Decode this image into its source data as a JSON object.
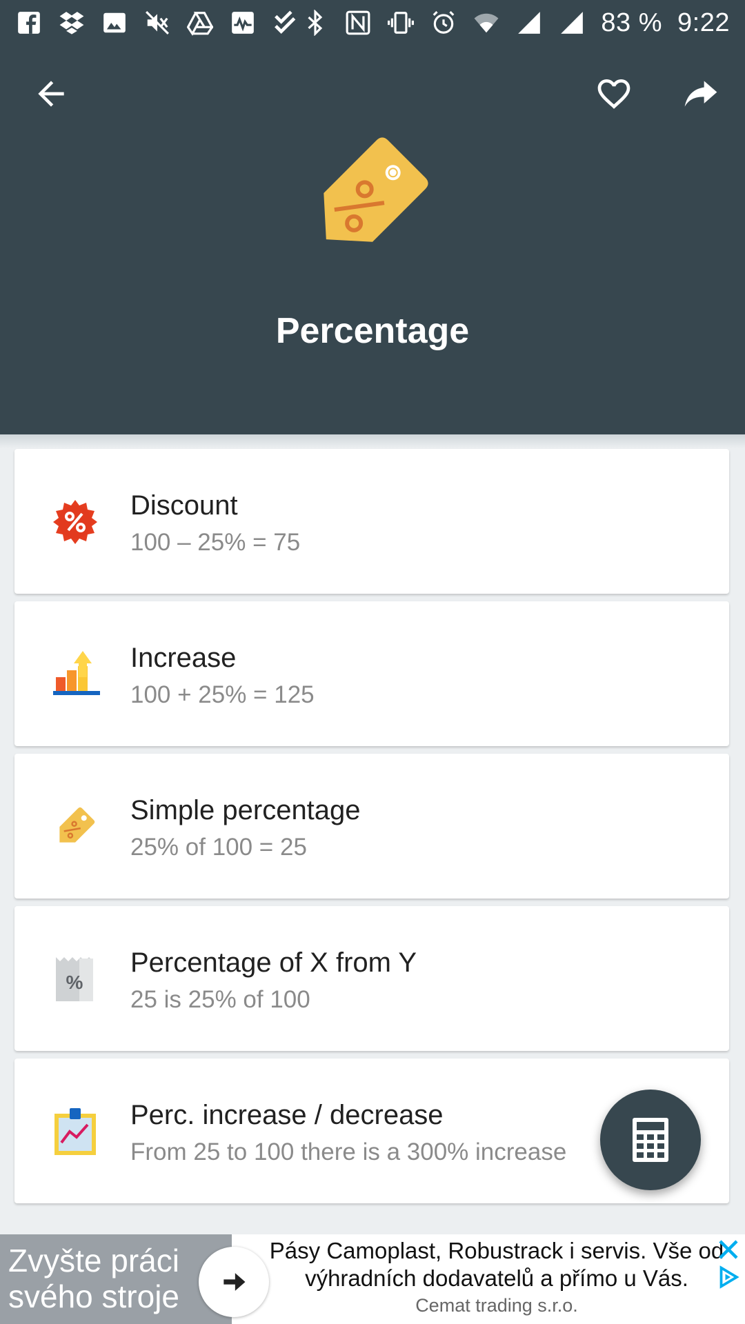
{
  "status_bar": {
    "battery": "83 %",
    "time": "9:22",
    "left_icons": [
      "facebook-icon",
      "dropbox-icon",
      "image-icon",
      "mute-icon",
      "drive-icon",
      "activity-icon",
      "checklist-icon"
    ],
    "right_icons": [
      "bluetooth-icon",
      "nfc-icon",
      "vibrate-icon",
      "alarm-icon",
      "wifi-icon",
      "signal-icon",
      "signal-icon-2"
    ]
  },
  "header": {
    "title": "Percentage",
    "background": "#37474F"
  },
  "items": [
    {
      "title": "Discount",
      "subtitle": "100 – 25% = 75",
      "icon": "discount-badge-icon"
    },
    {
      "title": "Increase",
      "subtitle": "100 + 25% = 125",
      "icon": "increase-chart-icon"
    },
    {
      "title": "Simple percentage",
      "subtitle": "25% of 100 = 25",
      "icon": "price-tag-icon"
    },
    {
      "title": "Percentage of X from Y",
      "subtitle": "25 is 25% of 100",
      "icon": "receipt-percent-icon"
    },
    {
      "title": "Perc. increase / decrease",
      "subtitle": "From 25 to 100 there is a 300% increase",
      "icon": "clipboard-chart-icon"
    }
  ],
  "fab": {
    "icon": "calculator-icon"
  },
  "ad": {
    "left_text": "Zvyšte práci\nsvého stroje",
    "text": "Pásy Camoplast, Robustrack i servis. Vše od výhradních dodavatelů a přímo u Vás.",
    "advertiser": "Cemat trading s.r.o."
  },
  "colors": {
    "accent_yellow": "#F2C14E",
    "header_dark": "#37474F",
    "discount_red": "#E53D1F",
    "ad_blue": "#00AEEF"
  }
}
